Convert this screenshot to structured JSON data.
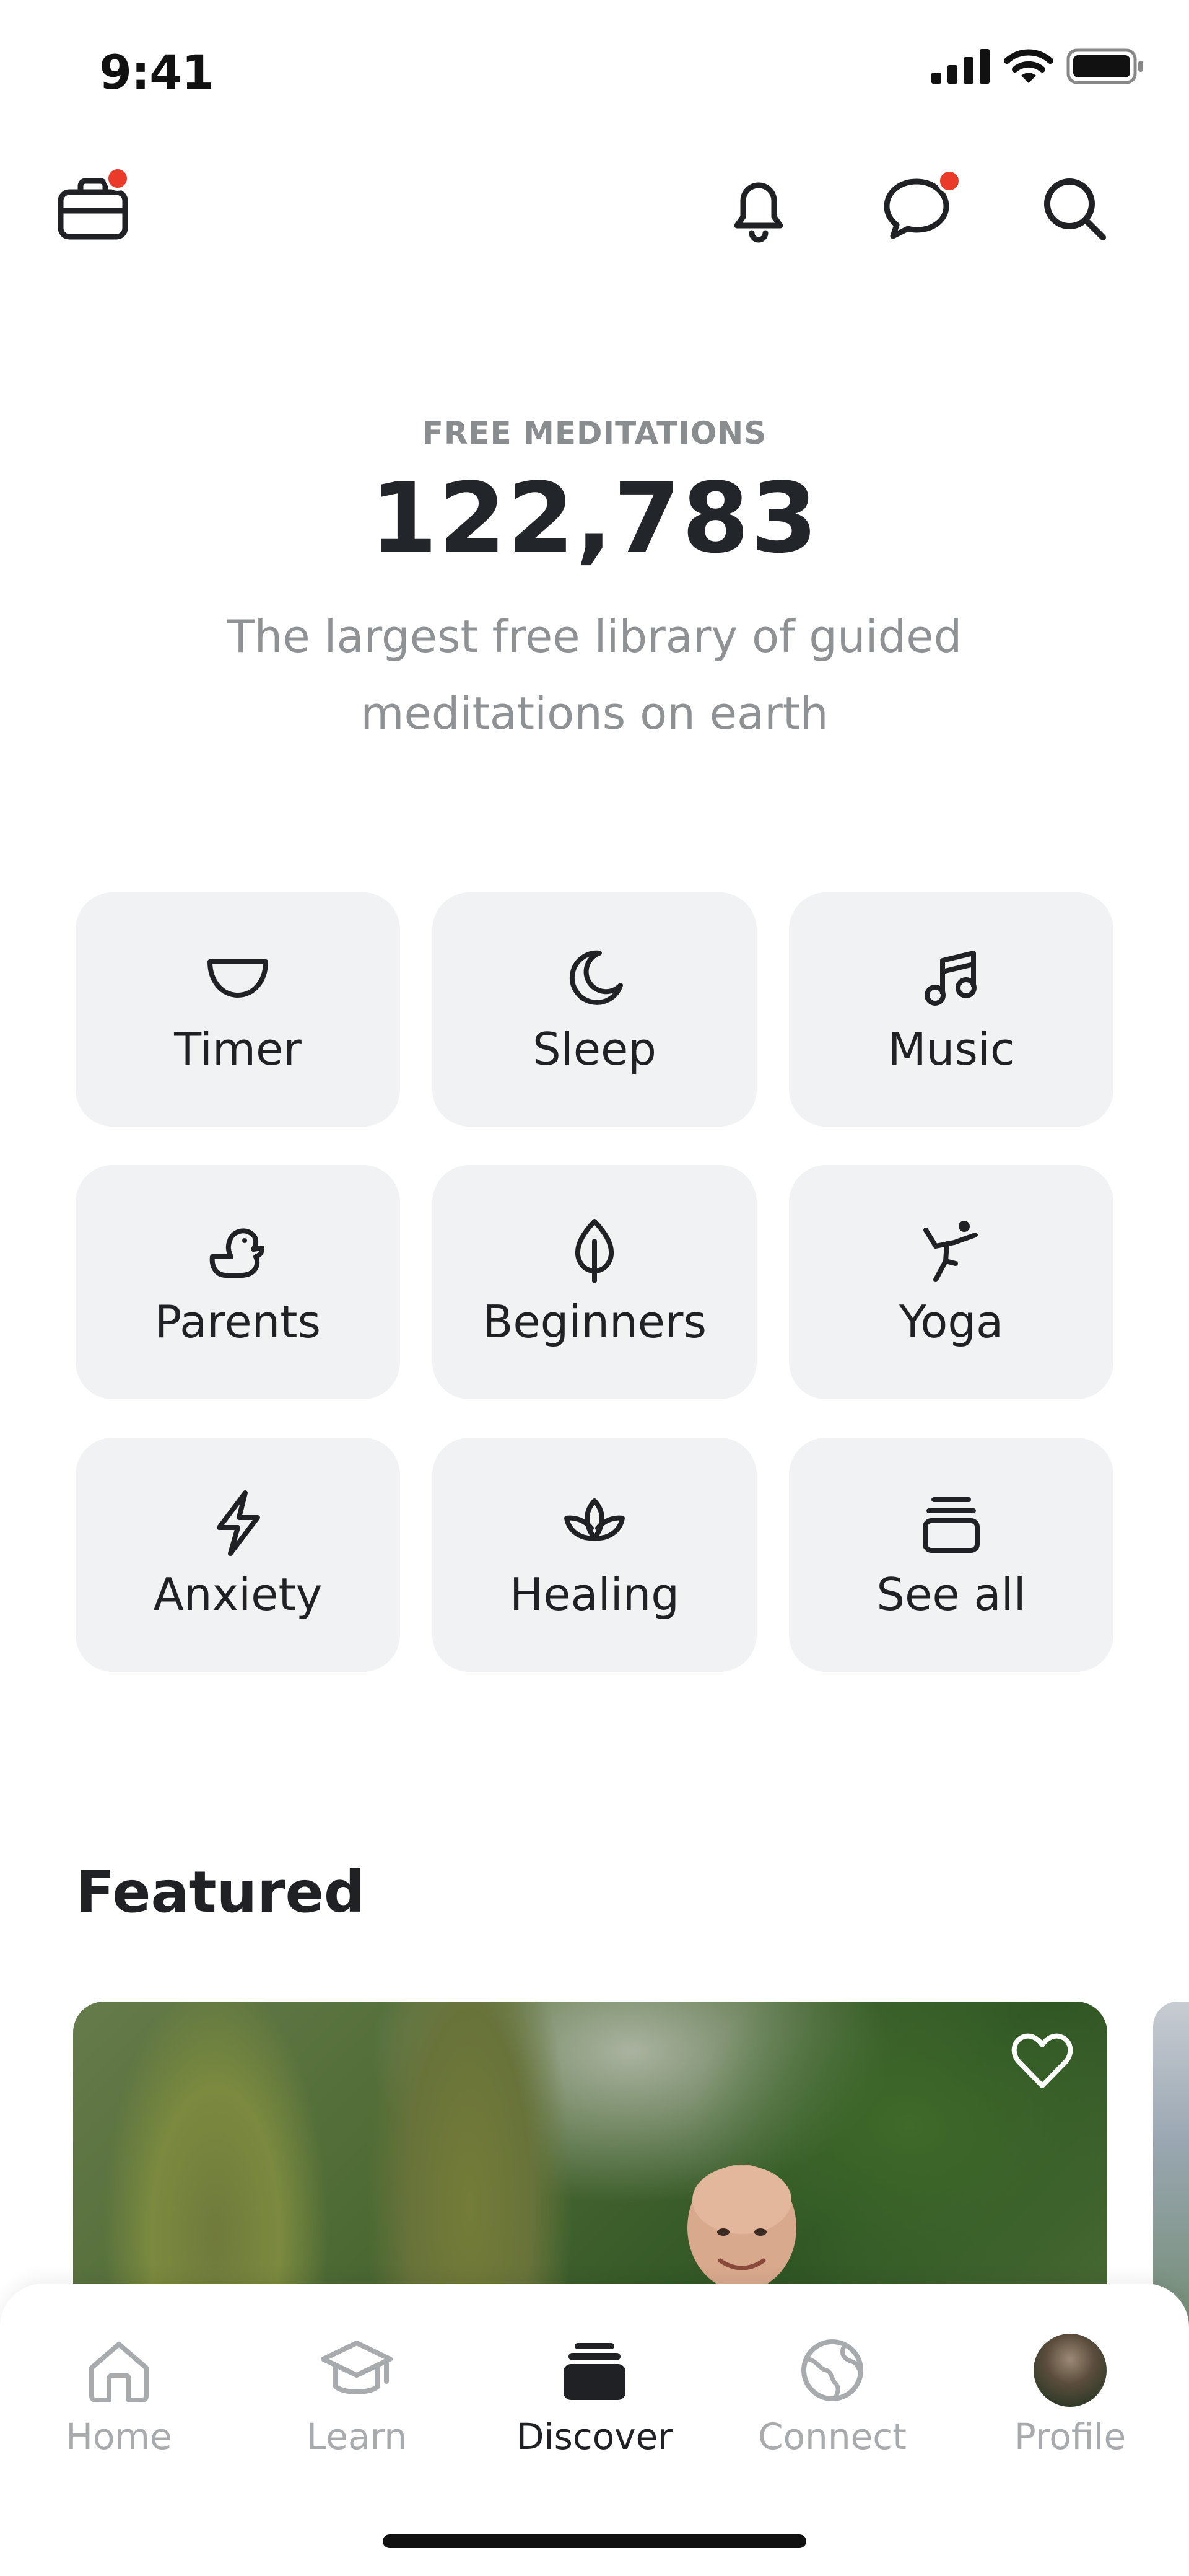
{
  "status_bar": {
    "time": "9:41"
  },
  "top_bar": {
    "left_icon": "briefcase-icon",
    "right_icons": [
      "bell-icon",
      "chat-icon",
      "search-icon"
    ]
  },
  "hero": {
    "kicker": "FREE MEDITATIONS",
    "count": "122,783",
    "subtitle": "The largest free library of guided meditations on earth"
  },
  "categories": [
    {
      "label": "Timer",
      "icon": "bowl-icon"
    },
    {
      "label": "Sleep",
      "icon": "moon-icon"
    },
    {
      "label": "Music",
      "icon": "music-note-icon"
    },
    {
      "label": "Parents",
      "icon": "duck-icon"
    },
    {
      "label": "Beginners",
      "icon": "leaf-icon"
    },
    {
      "label": "Yoga",
      "icon": "yoga-pose-icon"
    },
    {
      "label": "Anxiety",
      "icon": "lightning-icon"
    },
    {
      "label": "Healing",
      "icon": "lotus-icon"
    },
    {
      "label": "See all",
      "icon": "stack-icon"
    }
  ],
  "featured": {
    "title": "Featured"
  },
  "bottom_nav": {
    "items": [
      {
        "label": "Home",
        "icon": "home-icon",
        "active": false
      },
      {
        "label": "Learn",
        "icon": "graduation-cap-icon",
        "active": false
      },
      {
        "label": "Discover",
        "icon": "discover-stack-icon",
        "active": true
      },
      {
        "label": "Connect",
        "icon": "globe-icon",
        "active": false
      },
      {
        "label": "Profile",
        "icon": "avatar",
        "active": false
      }
    ]
  },
  "colors": {
    "accent_red": "#ea3a2a",
    "tile_bg": "#f0f2f3",
    "muted_text": "#8f9295"
  }
}
